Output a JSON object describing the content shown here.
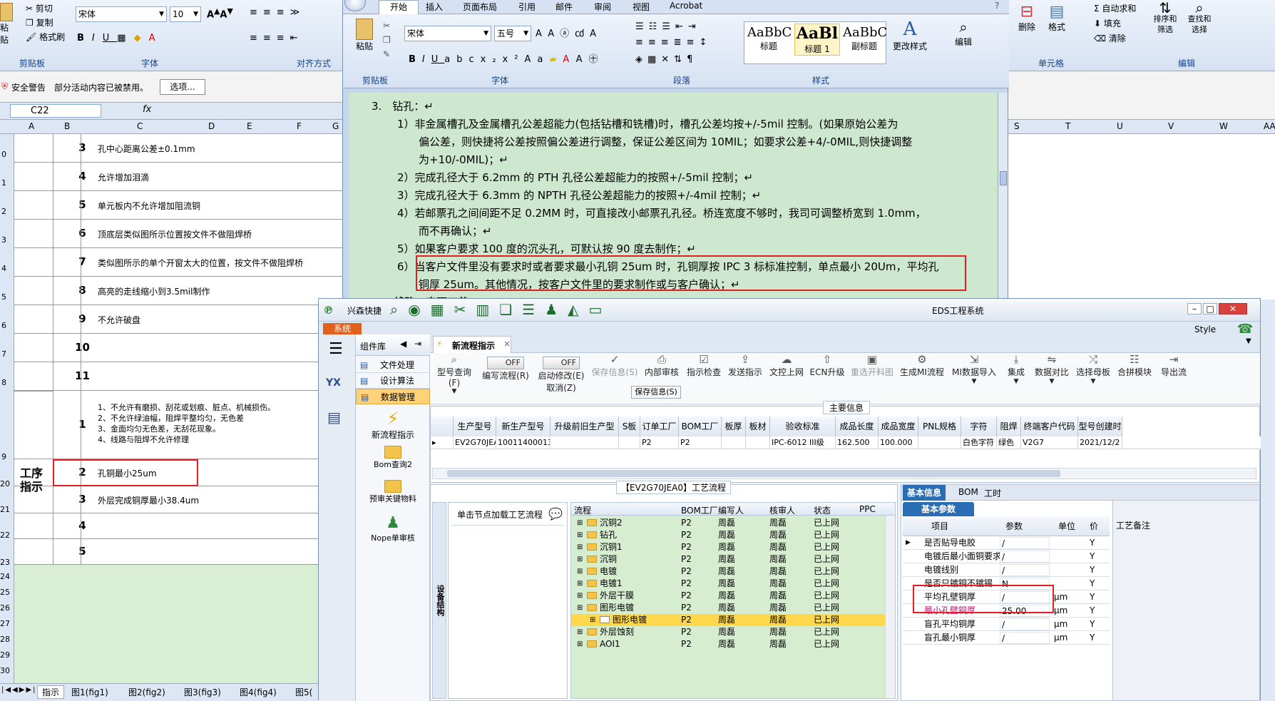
{
  "excel": {
    "clipboard": {
      "cut": "剪切",
      "copy": "复制",
      "format_painter": "格式刷",
      "paste": "粘贴",
      "group": "剪贴板"
    },
    "font": {
      "name": "宋体",
      "size": "10",
      "group": "字体"
    },
    "align_group": "对齐方式",
    "security": {
      "title": "安全警告",
      "text": "部分活动内容已被禁用。",
      "options": "选项..."
    },
    "namebox": "C22",
    "fx": "fx",
    "columns": [
      "A",
      "B",
      "C",
      "D",
      "E",
      "F",
      "G"
    ],
    "row_numbers": [
      "0",
      "1",
      "2",
      "3",
      "4",
      "5",
      "6",
      "7",
      "8",
      "9",
      "20",
      "21",
      "22",
      "23",
      "24",
      "25",
      "26",
      "27",
      "28",
      "29",
      "30",
      "31",
      "32"
    ],
    "section1_rows": [
      {
        "num": "3",
        "text": "孔中心距离公差±0.1mm"
      },
      {
        "num": "4",
        "text": "允许增加泪滴"
      },
      {
        "num": "5",
        "text": "单元板内不允许增加阻流铜"
      },
      {
        "num": "6",
        "text": "顶底层类似图所示位置按文件不做阻焊桥"
      },
      {
        "num": "7",
        "text": "类似图所示的单个开窗太大的位置，按文件不做阻焊桥"
      },
      {
        "num": "8",
        "text": "高亮的走线缩小到3.5mil制作"
      },
      {
        "num": "9",
        "text": "不允许破盘"
      },
      {
        "num": "10",
        "text": ""
      },
      {
        "num": "11",
        "text": ""
      }
    ],
    "section2_label": "工序指示",
    "section2_rows": [
      {
        "num": "1",
        "text": "1、不允许有磨损、刮花或划痕、脏点、机械损伤。\n2、不允许绿油幅，阻焊平整均匀，无色差\n3、金面均匀无色差，无刮花现象。\n4、线路与阻焊不允许修理"
      },
      {
        "num": "2",
        "text": "孔铜最小25um"
      },
      {
        "num": "3",
        "text": "外层完成铜厚最小38.4um"
      },
      {
        "num": "4",
        "text": ""
      },
      {
        "num": "5",
        "text": ""
      }
    ],
    "sheet_tabs": [
      "指示",
      "图1(fig1)",
      "图2(fig2)",
      "图3(fig3)",
      "图4(fig4)",
      "图5("
    ],
    "right_ribbon": {
      "autosum": "自动求和",
      "fill": "填充",
      "clear": "清除",
      "delete": "删除",
      "format": "格式",
      "sort": "排序和筛选",
      "find": "查找和选择",
      "cells_group": "单元格",
      "edit_group": "编辑"
    },
    "right_columns": [
      "S",
      "T",
      "U",
      "V",
      "W",
      "AA"
    ]
  },
  "word": {
    "tabs": [
      "开始",
      "插入",
      "页面布局",
      "引用",
      "邮件",
      "审阅",
      "视图",
      "Acrobat"
    ],
    "active_tab": "开始",
    "font_name": "宋体",
    "font_size": "五号",
    "paste": "粘贴",
    "groups": {
      "clipboard": "剪贴板",
      "font": "字体",
      "paragraph": "段落",
      "styles": "样式"
    },
    "styles": [
      {
        "preview": "AaBbC",
        "name": "标题"
      },
      {
        "preview": "AaBl",
        "name": "标题 1"
      },
      {
        "preview": "AaBbC",
        "name": "副标题"
      }
    ],
    "change_styles": "更改样式",
    "edit": "编辑",
    "doc_lines": [
      {
        "indent": 0,
        "text": "3.　钻孔：↵"
      },
      {
        "indent": 1,
        "text": "1）非金属槽孔及金属槽孔公差超能力(包括钻槽和铣槽)时，槽孔公差均按+/-5mil 控制。(如果原始公差为"
      },
      {
        "indent": 2,
        "text": "偏公差，则快捷将公差按照偏公差进行调整，保证公差区间为 10MIL；如要求公差+4/-0MIL,则快捷调整"
      },
      {
        "indent": 2,
        "text": "为+10/-0MIL)；↵"
      },
      {
        "indent": 1,
        "text": "2）完成孔径大于 6.2mm 的 PTH 孔径公差超能力的按照+/-5mil 控制；↵"
      },
      {
        "indent": 1,
        "text": "3）完成孔径大于 6.3mm 的 NPTH 孔径公差超能力的按照+/-4mil 控制；↵"
      },
      {
        "indent": 1,
        "text": "4）若邮票孔之间间距不足 0.2MM 时，可直接改小邮票孔孔径。桥连宽度不够时，我司可调整桥宽到 1.0mm，"
      },
      {
        "indent": 2,
        "text": "而不再确认；↵"
      },
      {
        "indent": 1,
        "text": "5）如果客户要求 100 度的沉头孔，可默认按 90 度去制作；↵"
      },
      {
        "indent": 1,
        "text": "6）当客户文件里没有要求时或者要求最小孔铜 25um 时，孔铜厚按 IPC 3 标标准控制，单点最小 20Um，平均孔"
      },
      {
        "indent": 2,
        "text": "铜厚 25um。其他情况，按客户文件里的要求制作或与客户确认；↵"
      },
      {
        "indent": 0,
        "text": "4.　线路　表面工艺"
      }
    ]
  },
  "eds": {
    "app_name": "兴森快捷",
    "title": "EDS工程系统",
    "system_tab": "系统",
    "style_label": "Style",
    "component_lib": "组件库",
    "nav_items": [
      "文件处理",
      "设计算法",
      "数据管理"
    ],
    "side_tools": [
      "新流程指示",
      "Bom查询2",
      "预审关键物料",
      "Nope单审核"
    ],
    "active_tab": "新流程指示",
    "toolbar": [
      {
        "icon": "magnifier",
        "label": "型号查询(F)"
      },
      {
        "icon": "toggle",
        "label": "编写流程(R)",
        "state": "OFF"
      },
      {
        "icon": "toggle",
        "label": "启动修改(E)",
        "state": "OFF",
        "sub": "取消(Z)"
      },
      {
        "icon": "check",
        "label": "保存信息(S)",
        "sub": "保存信息(S)",
        "disabled": true
      },
      {
        "icon": "printer",
        "label": "内部审核"
      },
      {
        "icon": "checklist",
        "label": "指示检查"
      },
      {
        "icon": "upload",
        "label": "发送指示"
      },
      {
        "icon": "cloud",
        "label": "文控上网"
      },
      {
        "icon": "upgrade",
        "label": "ECN升级"
      },
      {
        "icon": "image",
        "label": "重选开料图",
        "disabled": true
      },
      {
        "icon": "gears",
        "label": "生成MI流程"
      },
      {
        "icon": "import",
        "label": "MI数据导入"
      },
      {
        "icon": "merge",
        "label": "集成"
      },
      {
        "icon": "compare",
        "label": "数据对比"
      },
      {
        "icon": "swap",
        "label": "选择母板"
      },
      {
        "icon": "merge-module",
        "label": "合拼模块"
      },
      {
        "icon": "export",
        "label": "导出流"
      }
    ],
    "main_info_title": "主要信息",
    "main_columns": [
      "生产型号",
      "新生产型号",
      "升级前旧生产型号",
      "S板",
      "订单工厂",
      "BOM工厂",
      "板厚",
      "板材",
      "验收标准",
      "成品长度",
      "成品宽度",
      "PNL规格",
      "字符",
      "阻焊",
      "终端客户代码",
      "型号创建时"
    ],
    "main_row": [
      "EV2G70JEA0",
      "10011400013588",
      "",
      "",
      "P2",
      "P2",
      "",
      "",
      "IPC-6012 III级",
      "162.500",
      "100.000",
      "",
      "白色字符",
      "绿色",
      "V2G7",
      "2021/12/2"
    ],
    "flow_title": "【EV2G70JEA0】工艺流程",
    "flow_side_label": "设备结构",
    "flow_hint": "单击节点加载工艺流程",
    "flow_columns": [
      "流程",
      "BOM工厂",
      "编写人",
      "核审人",
      "状态",
      "PPC"
    ],
    "flow_rows": [
      {
        "name": "沉铜2",
        "bom": "P2",
        "writer": "周磊",
        "checker": "周磊",
        "status": "已上网",
        "level": 1
      },
      {
        "name": "钻孔",
        "bom": "P2",
        "writer": "周磊",
        "checker": "周磊",
        "status": "已上网",
        "level": 1
      },
      {
        "name": "沉铜1",
        "bom": "P2",
        "writer": "周磊",
        "checker": "周磊",
        "status": "已上网",
        "level": 1
      },
      {
        "name": "沉铜",
        "bom": "P2",
        "writer": "周磊",
        "checker": "周磊",
        "status": "已上网",
        "level": 1
      },
      {
        "name": "电镀",
        "bom": "P2",
        "writer": "周磊",
        "checker": "周磊",
        "status": "已上网",
        "level": 1
      },
      {
        "name": "电镀1",
        "bom": "P2",
        "writer": "周磊",
        "checker": "周磊",
        "status": "已上网",
        "level": 1
      },
      {
        "name": "外层干膜",
        "bom": "P2",
        "writer": "周磊",
        "checker": "周磊",
        "status": "已上网",
        "level": 1
      },
      {
        "name": "图形电镀",
        "bom": "P2",
        "writer": "周磊",
        "checker": "周磊",
        "status": "已上网",
        "level": 1
      },
      {
        "name": "图形电镀",
        "bom": "P2",
        "writer": "周磊",
        "checker": "周磊",
        "status": "已上网",
        "level": 2,
        "selected": true
      },
      {
        "name": "外层蚀刻",
        "bom": "P2",
        "writer": "周磊",
        "checker": "周磊",
        "status": "已上网",
        "level": 1
      },
      {
        "name": "AOI1",
        "bom": "P2",
        "writer": "周磊",
        "checker": "周磊",
        "status": "已上网",
        "level": 1
      }
    ],
    "info_tabs": [
      "基本信息",
      "BOM",
      "工时"
    ],
    "basic_params_title": "基本参数",
    "param_columns": [
      "项目",
      "参数",
      "单位",
      "价"
    ],
    "params": [
      {
        "item": "是否贴导电胶",
        "value": "/",
        "unit": "",
        "flag": "Y"
      },
      {
        "item": "电镀后最小面铜要求",
        "value": "/",
        "unit": "",
        "flag": "Y"
      },
      {
        "item": "电镀线别",
        "value": "/",
        "unit": "",
        "flag": "Y"
      },
      {
        "item": "是否只镀铜不镀锡",
        "value": "N",
        "unit": "",
        "flag": "Y"
      },
      {
        "item": "平均孔壁铜厚",
        "value": "/",
        "unit": "μm",
        "flag": "Y"
      },
      {
        "item": "最小孔壁铜厚",
        "value": "25.00",
        "unit": "μm",
        "flag": "Y",
        "highlight": true
      },
      {
        "item": "盲孔平均铜厚",
        "value": "/",
        "unit": "μm",
        "flag": "Y"
      },
      {
        "item": "盲孔最小铜厚",
        "value": "/",
        "unit": "μm",
        "flag": "Y"
      }
    ],
    "right_panel_label": "工艺备注"
  },
  "colors": {
    "highlight_red": "#e02020",
    "excel_header": "#dce6f4",
    "doc_bg": "#cde8cf",
    "eds_green": "#cfe9c5",
    "selected_row": "#ffd84d"
  }
}
